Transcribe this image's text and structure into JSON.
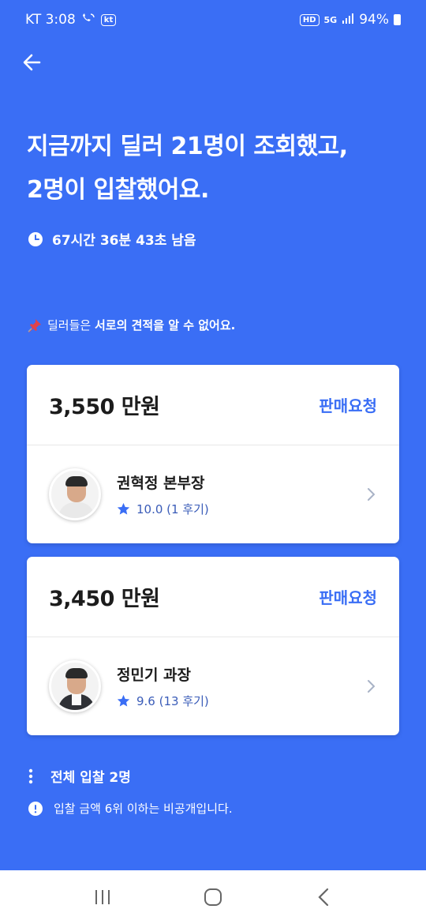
{
  "status_bar": {
    "carrier_time": "KT 3:08",
    "kt_badge": "kt",
    "hd_badge": "HD",
    "network": "5G",
    "battery": "94%"
  },
  "header": {
    "back_icon": "arrow-left-icon"
  },
  "headline": {
    "line1": "지금까지 딜러 21명이 조회했고,",
    "line2": "2명이 입찰했어요."
  },
  "timer": {
    "icon": "clock-icon",
    "text": "67시간 36분 43초 남음"
  },
  "notice": {
    "icon": "pushpin-icon",
    "prefix": "딜러들은 ",
    "bold": "서로의 견적을 알 수 없어요."
  },
  "bids": [
    {
      "price": "3,550 만원",
      "action": "판매요청",
      "dealer_name": "권혁정 본부장",
      "rating": "10.0 (1 후기)"
    },
    {
      "price": "3,450 만원",
      "action": "판매요청",
      "dealer_name": "정민기 과장",
      "rating": "9.6 (13 후기)"
    }
  ],
  "footer": {
    "total_label": "전체 입찰 2명",
    "private_note": "입찰 금액 6위 이하는 비공개입니다."
  },
  "colors": {
    "accent": "#3a6ef5",
    "card": "#ffffff",
    "rating": "#3a5cb8"
  }
}
